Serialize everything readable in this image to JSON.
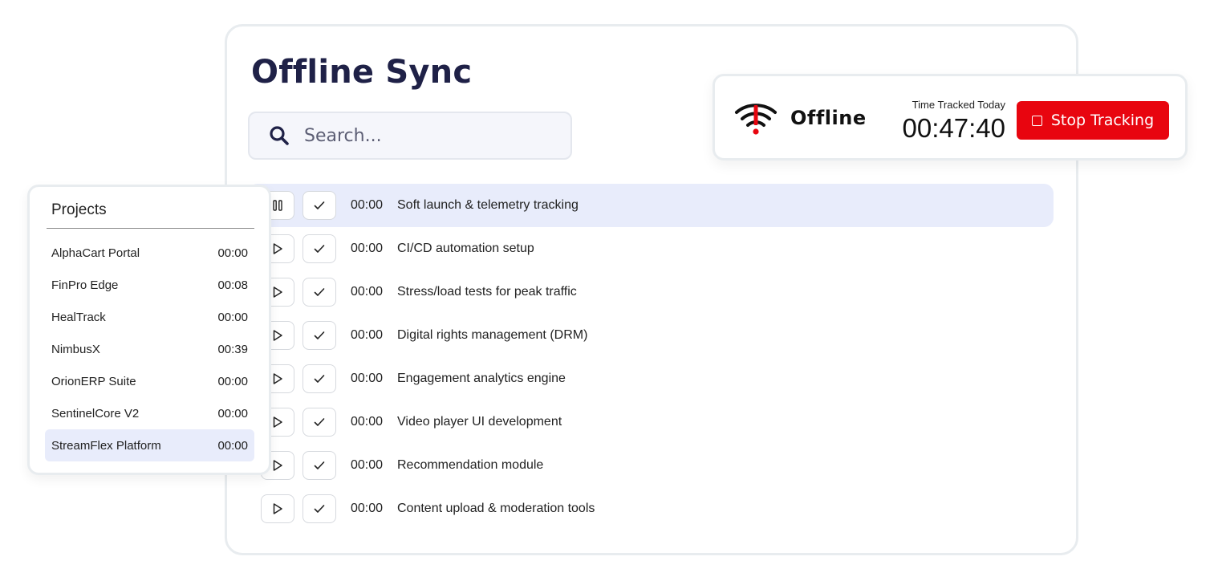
{
  "header": {
    "title": "Offline Sync"
  },
  "search": {
    "placeholder": "Search..."
  },
  "tracker": {
    "status": "Offline",
    "tracked_label": "Time Tracked Today",
    "tracked_value": "00:47:40",
    "stop_label": "Stop Tracking",
    "accent_color": "#e8050f"
  },
  "tasks": [
    {
      "time": "00:00",
      "name": "Soft launch & telemetry tracking",
      "state": "playing"
    },
    {
      "time": "00:00",
      "name": "CI/CD automation setup",
      "state": "paused"
    },
    {
      "time": "00:00",
      "name": "Stress/load tests for peak traffic",
      "state": "paused"
    },
    {
      "time": "00:00",
      "name": "Digital rights management (DRM)",
      "state": "paused"
    },
    {
      "time": "00:00",
      "name": "Engagement analytics engine",
      "state": "paused"
    },
    {
      "time": "00:00",
      "name": "Video player UI development",
      "state": "paused"
    },
    {
      "time": "00:00",
      "name": "Recommendation module",
      "state": "paused"
    },
    {
      "time": "00:00",
      "name": "Content upload & moderation tools",
      "state": "paused"
    }
  ],
  "projects": {
    "title": "Projects",
    "items": [
      {
        "name": "AlphaCart Portal",
        "time": "00:00"
      },
      {
        "name": "FinPro Edge",
        "time": "00:08"
      },
      {
        "name": "HealTrack",
        "time": "00:00"
      },
      {
        "name": "NimbusX",
        "time": "00:39"
      },
      {
        "name": "OrionERP Suite",
        "time": "00:00"
      },
      {
        "name": "SentinelCore V2",
        "time": "00:00"
      },
      {
        "name": "StreamFlex Platform",
        "time": "00:00"
      }
    ]
  }
}
